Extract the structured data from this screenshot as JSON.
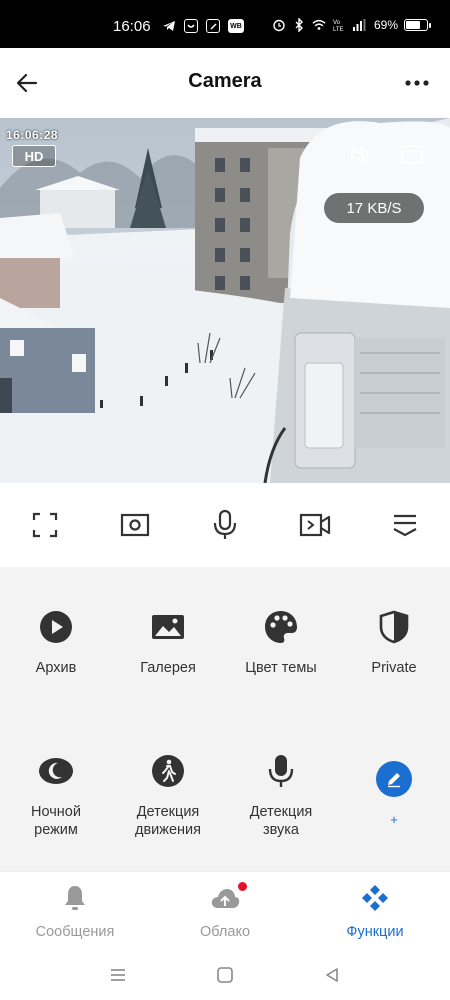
{
  "status_bar": {
    "time": "16:06",
    "battery_text": "69%",
    "battery_level": 0.69,
    "left_icons": [
      "telegram-icon",
      "chat-icon",
      "box-icon",
      "wb-icon"
    ],
    "wb_label": "WB",
    "right_icons": [
      "alarm-icon",
      "bluetooth-icon",
      "wifi-icon",
      "volte-icon",
      "signal-icon",
      "battery-icon"
    ]
  },
  "header": {
    "title": "Camera",
    "back_icon": "arrow-left-icon",
    "more_icon": "more-horizontal-icon"
  },
  "video": {
    "osd_time": "16:06:28",
    "quality_badge": "HD",
    "speed": "17 KB/S",
    "icons": [
      "mute-icon",
      "window-icon"
    ]
  },
  "controls": [
    {
      "name": "fullscreen-icon"
    },
    {
      "name": "snapshot-icon"
    },
    {
      "name": "microphone-icon"
    },
    {
      "name": "record-icon"
    },
    {
      "name": "collapse-icon"
    }
  ],
  "functions": [
    {
      "label": "Архив",
      "icon": "play-icon"
    },
    {
      "label": "Галерея",
      "icon": "image-icon"
    },
    {
      "label": "Цвет темы",
      "icon": "palette-icon"
    },
    {
      "label": "Private",
      "icon": "privacy-shield-icon"
    },
    {
      "label": "Ночной\nрежим",
      "icon": "moon-icon"
    },
    {
      "label": "Детекция\nдвижения",
      "icon": "motion-walk-icon"
    },
    {
      "label": "Детекция\nзвука",
      "icon": "mic-icon"
    },
    {
      "label": "+",
      "icon": "edit-icon"
    }
  ],
  "bottom_nav": [
    {
      "label": "Сообщения",
      "icon": "bell-icon",
      "active": false
    },
    {
      "label": "Облако",
      "icon": "cloud-upload-icon",
      "active": false,
      "badge": true
    },
    {
      "label": "Функции",
      "icon": "functions-diamond-icon",
      "active": true
    }
  ],
  "colors": {
    "accent": "#1a6fd0",
    "badge_red": "#e8102b",
    "panel_bg": "#f3f3f3"
  }
}
